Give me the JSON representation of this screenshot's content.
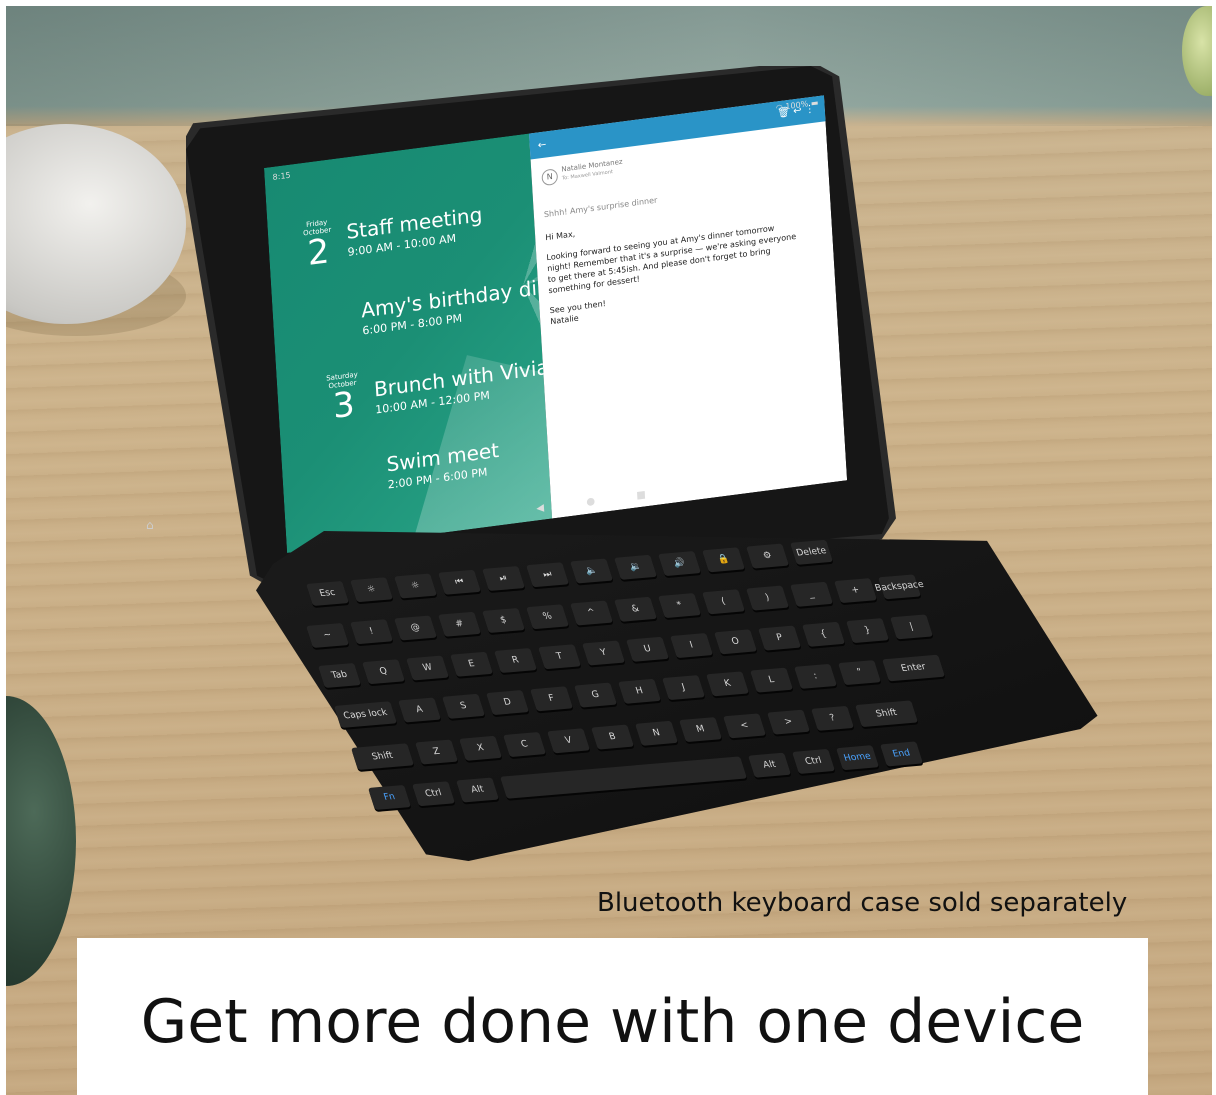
{
  "tablet_screen": {
    "status_time": "8:15",
    "status_battery": "100%",
    "agenda": [
      {
        "dow": "Friday",
        "month": "October",
        "day": "2",
        "title": "Staff meeting",
        "time": "9:00 AM - 10:00 AM"
      },
      {
        "title": "Amy's birthday dinner",
        "time": "6:00 PM - 8:00 PM"
      },
      {
        "dow": "Saturday",
        "month": "October",
        "day": "3",
        "title": "Brunch with Vivian",
        "time": "10:00 AM - 12:00 PM"
      },
      {
        "title": "Swim meet",
        "time": "2:00 PM - 6:00 PM"
      }
    ],
    "email": {
      "avatar_initial": "N",
      "sender": "Natalie Montanez",
      "recipient": "To: Maxwell Valmont",
      "subject": "Shhh! Amy's surprise dinner",
      "greeting": "Hi Max,",
      "body": "Looking forward to seeing you at Amy's dinner tomorrow night! Remember that it's a surprise — we're asking everyone to get there at 5:45ish. And please don't forget to bring something for dessert!",
      "closing": "See you then!",
      "signature": "Natalie"
    }
  },
  "keyboard": {
    "rows": [
      [
        "Esc",
        "☼",
        "☼",
        "⏮",
        "⏯",
        "⏭",
        "🔈",
        "🔉",
        "🔊",
        "🔒",
        "⚙",
        "Delete"
      ],
      [
        "~",
        "!",
        "@",
        "#",
        "$",
        "%",
        "^",
        "&",
        "*",
        "(",
        ")",
        "_",
        "+",
        "Backspace"
      ],
      [
        "Tab",
        "Q",
        "W",
        "E",
        "R",
        "T",
        "Y",
        "U",
        "I",
        "O",
        "P",
        "{",
        "}",
        "|"
      ],
      [
        "Caps lock",
        "A",
        "S",
        "D",
        "F",
        "G",
        "H",
        "J",
        "K",
        "L",
        ":",
        "\"",
        "Enter"
      ],
      [
        "Shift",
        "Z",
        "X",
        "C",
        "V",
        "B",
        "N",
        "M",
        "<",
        ">",
        "?",
        "Shift"
      ],
      [
        "Fn",
        "Ctrl",
        "Alt",
        "",
        "Alt",
        "Ctrl",
        "Home",
        "End"
      ]
    ]
  },
  "caption": "Bluetooth keyboard case sold separately",
  "headline": "Get more done with one device"
}
